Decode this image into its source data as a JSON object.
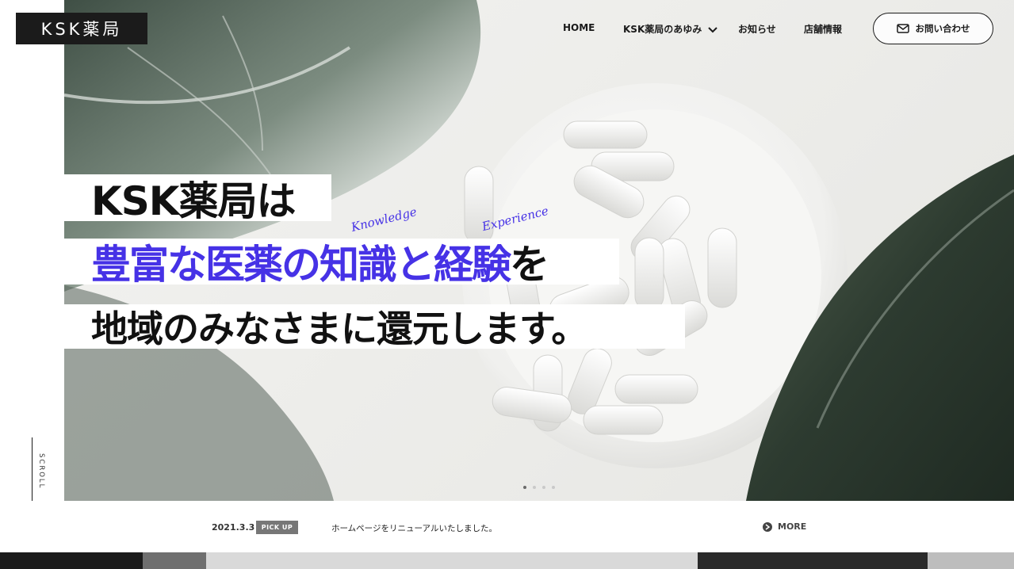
{
  "logo": {
    "text": "KSK薬局"
  },
  "nav": {
    "items": [
      {
        "label": "HOME"
      },
      {
        "label": "KSK薬局のあゆみ",
        "icon": "chevron-down-icon"
      },
      {
        "label": "お知らせ"
      },
      {
        "label": "店舗情報"
      }
    ],
    "contact": {
      "label": "お問い合わせ",
      "icon": "mail-icon"
    }
  },
  "hero": {
    "line1": "KSK薬局は",
    "line2_accent": "豊富な医薬の知識と経験",
    "line2_tail": "を",
    "line3": "地域のみなさまに還元します。",
    "script_knowledge": "Knowledge",
    "script_experience": "Experience",
    "slider": {
      "total": 4,
      "active": 1
    }
  },
  "scroll": {
    "label": "SCROLL"
  },
  "news": {
    "date": "2021.3.3",
    "badge": "PICK UP",
    "text": "ホームページをリニューアルいたしました。",
    "more": "MORE"
  },
  "colors": {
    "accent": "#4632e6",
    "dark": "#1b1b1b",
    "badge": "#777777"
  }
}
